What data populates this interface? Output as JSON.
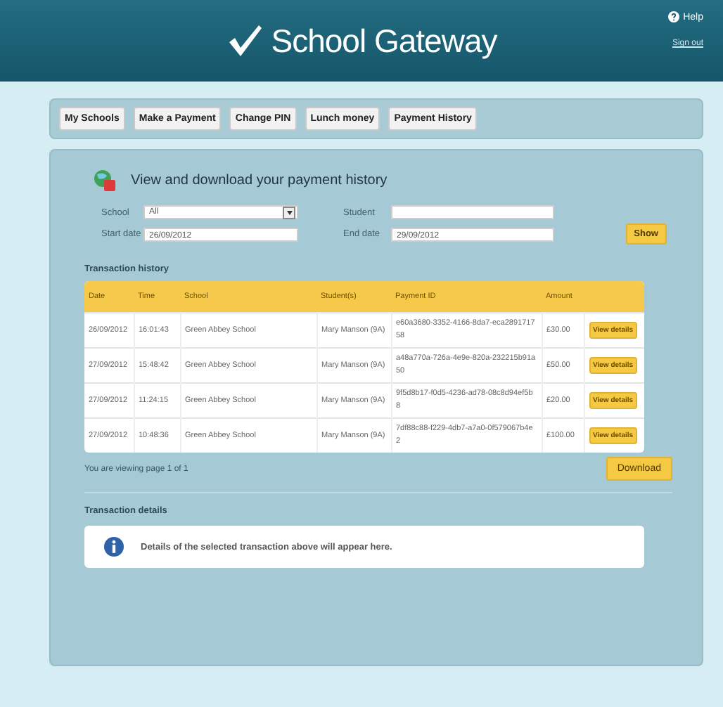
{
  "header": {
    "title": "School Gateway",
    "help": "Help",
    "sign_out": "Sign out"
  },
  "nav": [
    "My Schools",
    "Make a Payment",
    "Change PIN",
    "Lunch money",
    "Payment History"
  ],
  "heading": "View and download your payment history",
  "filters": {
    "school_label": "School",
    "school_value": "All",
    "student_label": "Student",
    "start_label": "Start date",
    "start_value": "26/09/2012",
    "end_label": "End date",
    "end_value": "29/09/2012",
    "show": "Show"
  },
  "history_title": "Transaction history",
  "table": {
    "columns": [
      "Date",
      "Time",
      "School",
      "Student(s)",
      "Payment ID",
      "Amount"
    ],
    "rows": [
      {
        "date": "26/09/2012",
        "time": "16:01:43",
        "school": "Green Abbey School",
        "student": "Mary Manson (9A)",
        "payment_id": "e60a3680-3352-4166-8da7-eca289171758",
        "amount": "£30.00",
        "action": "View details"
      },
      {
        "date": "27/09/2012",
        "time": "15:48:42",
        "school": "Green Abbey School",
        "student": "Mary Manson (9A)",
        "payment_id": "a48a770a-726a-4e9e-820a-232215b91a50",
        "amount": "£50.00",
        "action": "View details"
      },
      {
        "date": "27/09/2012",
        "time": "11:24:15",
        "school": "Green Abbey School",
        "student": "Mary Manson (9A)",
        "payment_id": "9f5d8b17-f0d5-4236-ad78-08c8d94ef5b8",
        "amount": "£20.00",
        "action": "View details"
      },
      {
        "date": "27/09/2012",
        "time": "10:48:36",
        "school": "Green Abbey School",
        "student": "Mary Manson (9A)",
        "payment_id": "7df88c88-f229-4db7-a7a0-0f579067b4e2",
        "amount": "£100.00",
        "action": "View details"
      }
    ]
  },
  "paging": "You are viewing page 1 of 1",
  "download": "Download",
  "details_title": "Transaction details",
  "details_message": "Details of the selected transaction above will appear here."
}
